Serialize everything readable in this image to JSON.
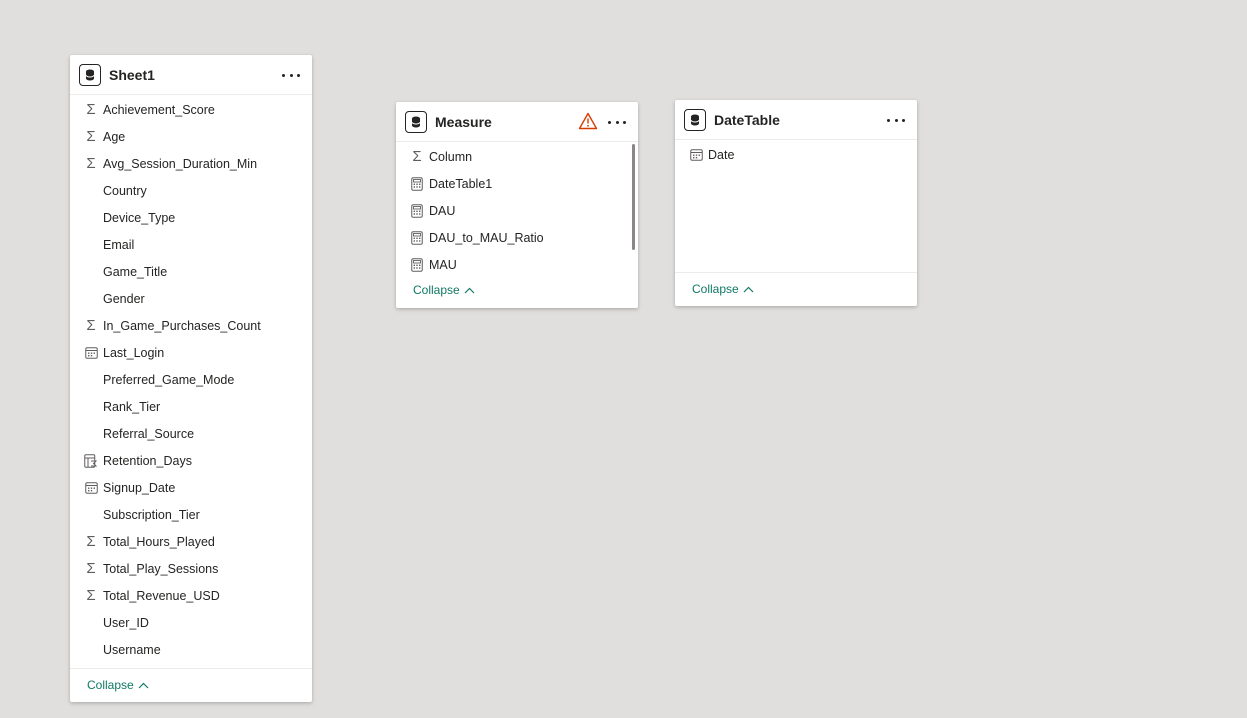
{
  "sheet1": {
    "title": "Sheet1",
    "collapse_label": "Collapse",
    "fields": [
      {
        "label": "Achievement_Score",
        "icon": "sigma-icon"
      },
      {
        "label": "Age",
        "icon": "sigma-icon"
      },
      {
        "label": "Avg_Session_Duration_Min",
        "icon": "sigma-icon"
      },
      {
        "label": "Country",
        "icon": "none"
      },
      {
        "label": "Device_Type",
        "icon": "none"
      },
      {
        "label": "Email",
        "icon": "none"
      },
      {
        "label": "Game_Title",
        "icon": "none"
      },
      {
        "label": "Gender",
        "icon": "none"
      },
      {
        "label": "In_Game_Purchases_Count",
        "icon": "sigma-icon"
      },
      {
        "label": "Last_Login",
        "icon": "calendar-icon"
      },
      {
        "label": "Preferred_Game_Mode",
        "icon": "none"
      },
      {
        "label": "Rank_Tier",
        "icon": "none"
      },
      {
        "label": "Referral_Source",
        "icon": "none"
      },
      {
        "label": "Retention_Days",
        "icon": "calculated-column-icon"
      },
      {
        "label": "Signup_Date",
        "icon": "calendar-icon"
      },
      {
        "label": "Subscription_Tier",
        "icon": "none"
      },
      {
        "label": "Total_Hours_Played",
        "icon": "sigma-icon"
      },
      {
        "label": "Total_Play_Sessions",
        "icon": "sigma-icon"
      },
      {
        "label": "Total_Revenue_USD",
        "icon": "sigma-icon"
      },
      {
        "label": "User_ID",
        "icon": "none"
      },
      {
        "label": "Username",
        "icon": "none"
      }
    ]
  },
  "measure": {
    "title": "Measure",
    "collapse_label": "Collapse",
    "warning_icon": "warning-icon",
    "fields": [
      {
        "label": "Column",
        "icon": "sigma-icon"
      },
      {
        "label": "DateTable1",
        "icon": "calculator-icon"
      },
      {
        "label": "DAU",
        "icon": "calculator-icon"
      },
      {
        "label": "DAU_to_MAU_Ratio",
        "icon": "calculator-icon"
      },
      {
        "label": "MAU",
        "icon": "calculator-icon"
      }
    ]
  },
  "datetable": {
    "title": "DateTable",
    "collapse_label": "Collapse",
    "fields": [
      {
        "label": "Date",
        "icon": "calendar-icon"
      }
    ]
  },
  "colors": {
    "canvas": "#e1dfdd",
    "card": "#ffffff",
    "text": "#252423",
    "link": "#117865",
    "warning": "#d83b01"
  }
}
